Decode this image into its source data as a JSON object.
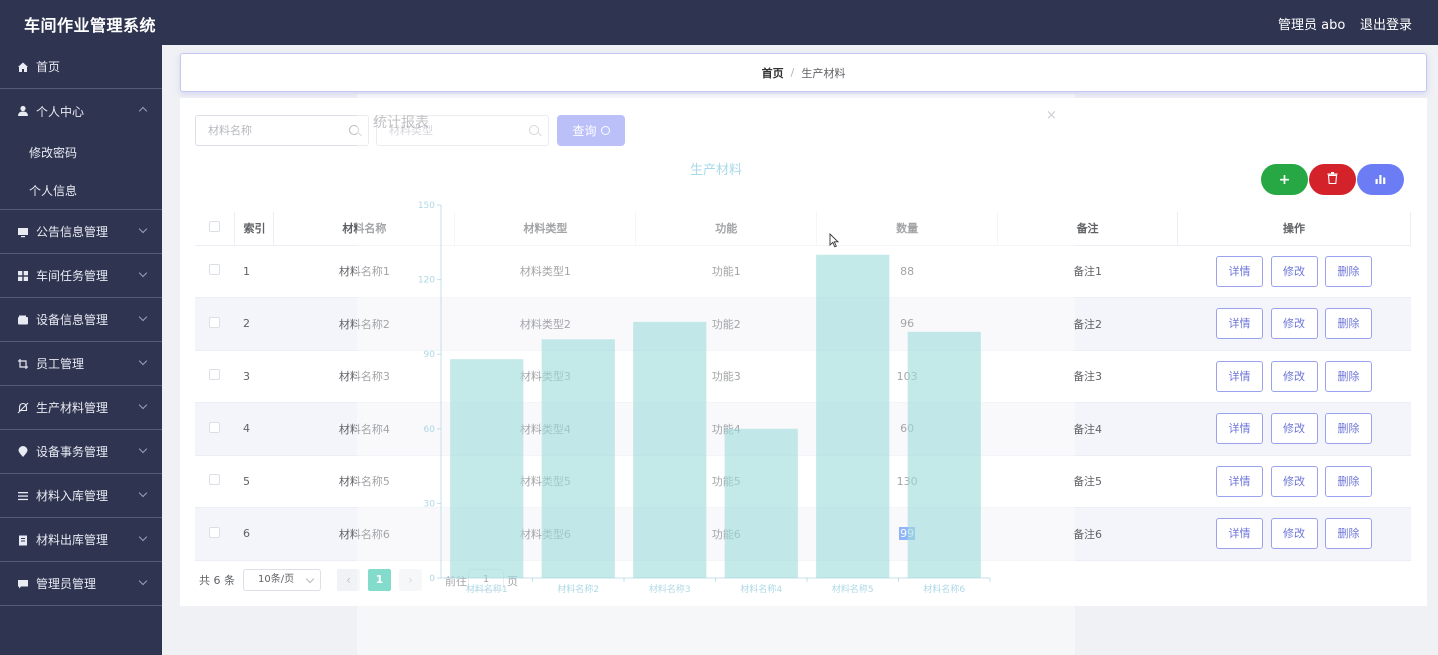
{
  "header": {
    "title": "车间作业管理系统",
    "user": "管理员 abo",
    "logout": "退出登录"
  },
  "sidebar": {
    "home": "首页",
    "personal": "个人中心",
    "personal_sub": [
      "修改密码",
      "个人信息"
    ],
    "items": [
      "公告信息管理",
      "车间任务管理",
      "设备信息管理",
      "员工管理",
      "生产材料管理",
      "设备事务管理",
      "材料入库管理",
      "材料出库管理",
      "管理员管理"
    ]
  },
  "breadcrumb": {
    "home": "首页",
    "separator": "/",
    "current": "生产材料"
  },
  "search": {
    "name_placeholder": "材料名称",
    "type_placeholder": "材料类型",
    "query_label": "查询"
  },
  "actions": {
    "add_color": "#28a745",
    "delete_color": "#d4222a",
    "stats_color": "#6c7cf5"
  },
  "table": {
    "headers": [
      "索引",
      "材料名称",
      "材料类型",
      "功能",
      "数量",
      "备注",
      "操作"
    ],
    "rows": [
      {
        "index": "1",
        "name": "材料名称1",
        "type": "材料类型1",
        "func": "功能1",
        "qty": "88",
        "note": "备注1"
      },
      {
        "index": "2",
        "name": "材料名称2",
        "type": "材料类型2",
        "func": "功能2",
        "qty": "96",
        "note": "备注2"
      },
      {
        "index": "3",
        "name": "材料名称3",
        "type": "材料类型3",
        "func": "功能3",
        "qty": "103",
        "note": "备注3"
      },
      {
        "index": "4",
        "name": "材料名称4",
        "type": "材料类型4",
        "func": "功能4",
        "qty": "60",
        "note": "备注4"
      },
      {
        "index": "5",
        "name": "材料名称5",
        "type": "材料类型5",
        "func": "功能5",
        "qty": "130",
        "note": "备注5"
      },
      {
        "index": "6",
        "name": "材料名称6",
        "type": "材料类型6",
        "func": "功能6",
        "qty": "99",
        "note": "备注6"
      }
    ],
    "op_labels": {
      "detail": "详情",
      "edit": "修改",
      "delete": "删除"
    }
  },
  "pagination": {
    "total": "共 6 条",
    "page_size": "10条/页",
    "prev": "‹",
    "current_page": "1",
    "next": "›",
    "goto_prefix": "前往",
    "goto_value": "1",
    "goto_suffix": "页"
  },
  "dialog": {
    "title": "统计报表",
    "close": "×"
  },
  "chart_data": {
    "type": "bar",
    "title": "生产材料",
    "categories": [
      "材料名称1",
      "材料名称2",
      "材料名称3",
      "材料名称4",
      "材料名称5",
      "材料名称6"
    ],
    "values": [
      88,
      96,
      103,
      60,
      130,
      99
    ],
    "ylim": [
      0,
      150
    ],
    "yticks": [
      0,
      30,
      60,
      90,
      120,
      150
    ],
    "color": "#9fdcdc",
    "grid": false
  }
}
